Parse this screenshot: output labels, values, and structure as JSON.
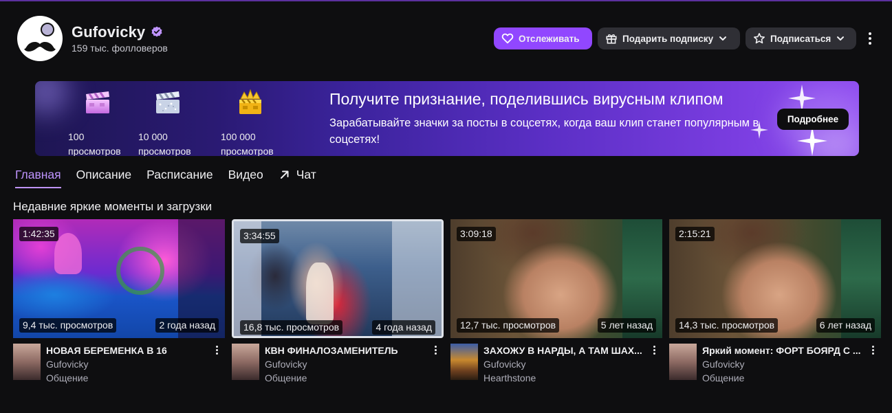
{
  "channel": {
    "name": "Gufovicky",
    "followers": "159 тыс. фолловеров"
  },
  "actions": {
    "follow_label": "Отслеживать",
    "gift_label": "Подарить подписку",
    "subscribe_label": "Подписаться"
  },
  "banner": {
    "title": "Получите признание, поделившись вирусным клипом",
    "text": "Зарабатывайте значки за посты в соцсетях, когда ваш клип станет популярным в соцсетях!",
    "button_label": "Подробнее",
    "badges": [
      {
        "count": "100",
        "label": "просмотров",
        "icon": "clip-badge-icon"
      },
      {
        "count": "10 000",
        "label": "просмотров",
        "icon": "glitter-clip-badge-icon"
      },
      {
        "count": "100 000",
        "label": "просмотров",
        "icon": "crown-clip-badge-icon"
      }
    ]
  },
  "tabs": [
    "Главная",
    "Описание",
    "Расписание",
    "Видео",
    "Чат"
  ],
  "section_title": "Недавние яркие моменты и загрузки",
  "videos": [
    {
      "duration": "1:42:35",
      "views": "9,4 тыс. просмотров",
      "ago": "2 года назад",
      "title": "НОВАЯ БЕРЕМЕНКА В 16",
      "channel": "Gufovicky",
      "category": "Общение"
    },
    {
      "duration": "3:34:55",
      "views": "16,8 тыс. просмотров",
      "ago": "4 года назад",
      "title": "КВН ФИНАЛОЗАМЕНИТЕЛЬ",
      "channel": "Gufovicky",
      "category": "Общение"
    },
    {
      "duration": "3:09:18",
      "views": "12,7 тыс. просмотров",
      "ago": "5 лет назад",
      "title": "ЗАХОЖУ В НАРДЫ, А ТАМ ШАХ...",
      "channel": "Gufovicky",
      "category": "Hearthstone"
    },
    {
      "duration": "2:15:21",
      "views": "14,3 тыс. просмотров",
      "ago": "6 лет назад",
      "title": "Яркий момент: ФОРТ БОЯРД С ...",
      "channel": "Gufovicky",
      "category": "Общение"
    }
  ],
  "colors": {
    "accent": "#9147ff",
    "accent_text": "#bf94ff",
    "background": "#0e0e10",
    "button_bg": "#2f2f35"
  }
}
